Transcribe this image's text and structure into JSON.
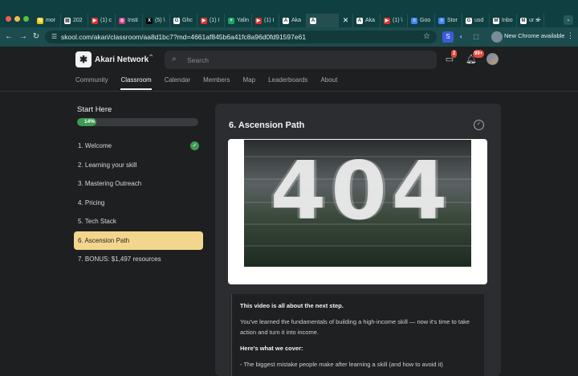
{
  "browser": {
    "tabs": [
      {
        "label": "mor",
        "icon": "notes-icon",
        "color": "#f0c419",
        "glyph": "N"
      },
      {
        "label": "202",
        "icon": "doc-icon",
        "color": "#ffffff",
        "glyph": "▤"
      },
      {
        "label": "(1) c",
        "icon": "youtube-icon",
        "color": "#e0302b",
        "glyph": "▶"
      },
      {
        "label": "Insti",
        "icon": "instagram-icon",
        "color": "#c13584",
        "glyph": "◎"
      },
      {
        "label": "(5) \\",
        "icon": "x-icon",
        "color": "#000000",
        "glyph": "X"
      },
      {
        "label": "Ghc",
        "icon": "ghost-icon",
        "color": "#ffffff",
        "glyph": "G"
      },
      {
        "label": "(1) I",
        "icon": "youtube-icon",
        "color": "#e0302b",
        "glyph": "▶"
      },
      {
        "label": "Yalin",
        "icon": "sheets-icon",
        "color": "#1fa463",
        "glyph": "+"
      },
      {
        "label": "(1) I",
        "icon": "youtube-icon",
        "color": "#e0302b",
        "glyph": "▶"
      },
      {
        "label": "Aka",
        "icon": "skool-icon",
        "color": "#ffffff",
        "glyph": "A"
      },
      {
        "label": "",
        "icon": "skool-icon",
        "color": "#ffffff",
        "glyph": "A"
      },
      {
        "label": "Aka",
        "icon": "skool-icon",
        "color": "#ffffff",
        "glyph": "A"
      },
      {
        "label": "(1) \\",
        "icon": "youtube-icon",
        "color": "#e0302b",
        "glyph": "▶"
      },
      {
        "label": "Goo",
        "icon": "docs-icon",
        "color": "#4285f4",
        "glyph": "≡"
      },
      {
        "label": "Stor",
        "icon": "docs-icon",
        "color": "#4285f4",
        "glyph": "≡"
      },
      {
        "label": "usd",
        "icon": "google-icon",
        "color": "#ffffff",
        "glyph": "G"
      },
      {
        "label": "Inbo",
        "icon": "gmail-icon",
        "color": "#ffffff",
        "glyph": "M"
      },
      {
        "label": "ur s",
        "icon": "gmail-icon",
        "color": "#ffffff",
        "glyph": "M"
      }
    ],
    "close_tab": "✕",
    "new_tab": "+",
    "tab_menu": "⌄",
    "url": "skool.com/akari/classroom/aa8d1bc7?md=4661af845b6a41fc8a96d0fd91597e61",
    "new_chrome": "New Chrome available",
    "kebab": "⋮"
  },
  "header": {
    "logo_glyph": "✱",
    "brand": "Akari Network",
    "switch_glyph": "⌃",
    "search_placeholder": "Search",
    "chat_badge": "2",
    "notif_badge": "99+",
    "nav": [
      "Community",
      "Classroom",
      "Calendar",
      "Members",
      "Map",
      "Leaderboards",
      "About"
    ],
    "active_nav": "Classroom"
  },
  "sidebar": {
    "title": "Start Here",
    "progress_label": "14%",
    "progress_value": 14,
    "lessons": [
      {
        "label": "1. Welcome",
        "done": true,
        "active": false
      },
      {
        "label": "2. Learning your skill",
        "done": false,
        "active": false
      },
      {
        "label": "3. Mastering Outreach",
        "done": false,
        "active": false
      },
      {
        "label": "4. Pricing",
        "done": false,
        "active": false
      },
      {
        "label": "5. Tech Stack",
        "done": false,
        "active": false
      },
      {
        "label": "6. Ascension Path",
        "done": false,
        "active": true
      },
      {
        "label": "7. BONUS: $1,497 resources",
        "done": false,
        "active": false
      }
    ],
    "check_glyph": "✓"
  },
  "lesson": {
    "title": "6. Ascension Path",
    "check_glyph": "✓",
    "video_text": "404",
    "description": {
      "intro": "This video is all about the next step.",
      "body": "You've learned the fundamentals of building a high-income skill — now it's time to take action and turn it into income.",
      "cover_heading": "Here's what we cover:",
      "bullet1": "- The biggest mistake people make after learning a skill (and how to avoid it)"
    }
  }
}
